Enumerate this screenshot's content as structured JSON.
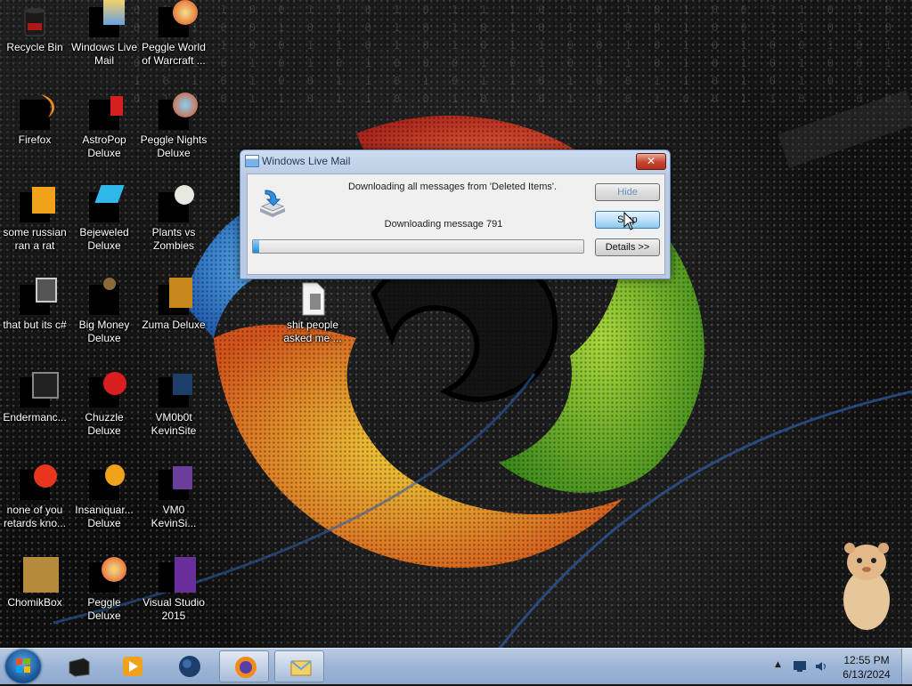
{
  "desktop": {
    "binary_rows": [
      "0 1 1 1 0 0 1 1 0 1 0 1 1 1 0 1 0 1 0 1 0 0 1 1 0 1 0 1 0 1 0 0 1 0 0",
      "0 1 1 0 0 1 0 1 0 1 0 1 0 1 0 1 1 0 0 1 0 0 1 1 0 1 0 0 1 1 1 0 1 0 1 1",
      "1 0 0 1 0 0 1 1 0 1 0 1 0 1 1 0 0 1 0 1 0 1 0 0 1 0 1 0 0 1 0 0 1 1 0 1",
      "0 0 1 0 1 0 1 0 1 0 0 0 1 0 1 0 1 1 0 1 0 1 0 1 0 0 1 0 1 1 0 0 1 1 0 1",
      "1 0 1 0 1 0 0 1 1 0 1 0 1 1 0 1 0 0 1 1 0 1 0 1 0 1 1 0 0 1 0 1 1 0 1 0",
      "0 1 0 0 1 1 0 1 1 0 0 1 0 1 0 1 1 0 1 0 0 1 1 0 1 0 0 1 1 0 1 0 1 0 0 1"
    ],
    "icons": [
      {
        "label": "Recycle Bin"
      },
      {
        "label": "Windows Live Mail"
      },
      {
        "label": "Peggle World of Warcraft ..."
      },
      {
        "label": "Firefox"
      },
      {
        "label": "AstroPop Deluxe"
      },
      {
        "label": "Peggle Nights Deluxe"
      },
      {
        "label": "some russian ran a rat"
      },
      {
        "label": "Bejeweled Deluxe"
      },
      {
        "label": "Plants vs Zombies"
      },
      {
        "label": "that but its c#"
      },
      {
        "label": "Big Money Deluxe"
      },
      {
        "label": "Zuma Deluxe"
      },
      {
        "label": "Endermanc..."
      },
      {
        "label": "Chuzzle Deluxe"
      },
      {
        "label": "VM0b0t KevinSite"
      },
      {
        "label": "none of you retards kno..."
      },
      {
        "label": "Insaniquar... Deluxe"
      },
      {
        "label": "VM0 KevinSi..."
      },
      {
        "label": "ChomikBox"
      },
      {
        "label": "Peggle Deluxe"
      },
      {
        "label": "Visual Studio 2015"
      },
      {
        "label": "shit people asked me ..."
      }
    ]
  },
  "dialog": {
    "title": "Windows Live Mail",
    "close_label": "✕",
    "message": "Downloading all messages from 'Deleted Items'.",
    "status": "Downloading message 791",
    "progress": 0.02,
    "hide_label": "Hide",
    "stop_label": "Stop",
    "details_label": "Details >>"
  },
  "taskbar": {
    "time": "12:55 PM",
    "date": "6/13/2024",
    "tray_arrow": "▲"
  },
  "colors": {
    "accent": "#1c8ad6",
    "taskbar": "#9db5d6"
  }
}
